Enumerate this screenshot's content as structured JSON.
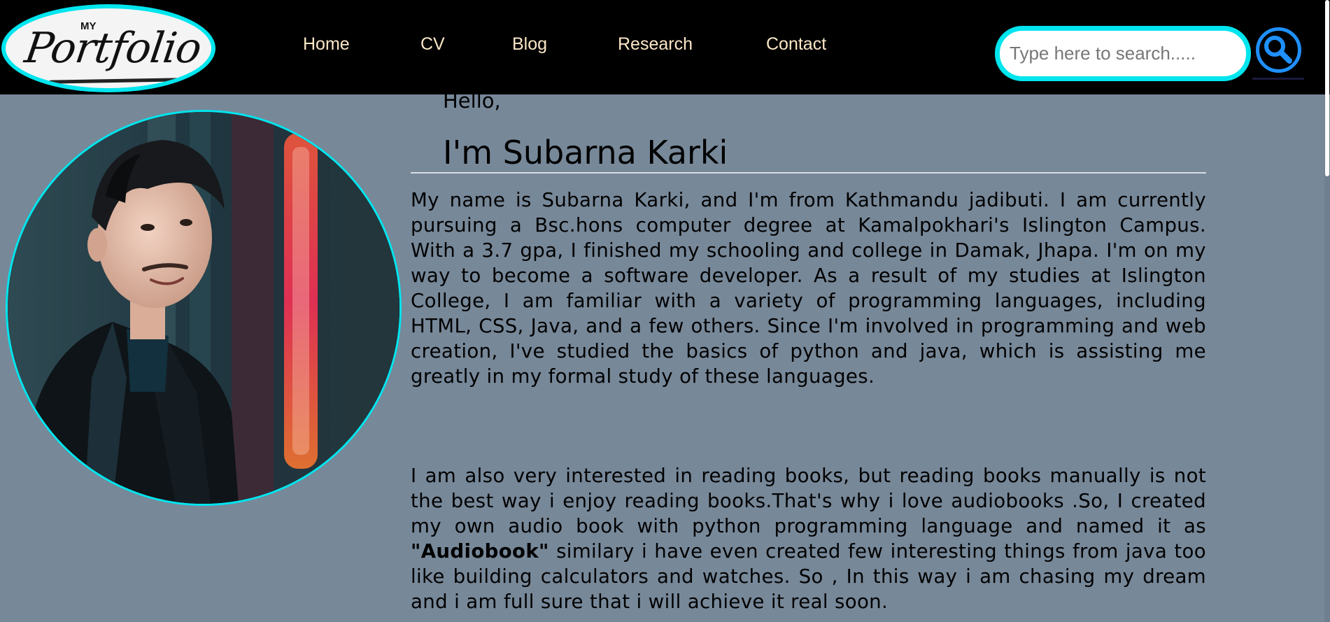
{
  "header": {
    "logo": {
      "small_text": "MY",
      "word": "Portfolio"
    },
    "nav": [
      {
        "label": "Home"
      },
      {
        "label": "CV"
      },
      {
        "label": "Blog"
      },
      {
        "label": "Research"
      },
      {
        "label": "Contact"
      }
    ],
    "search": {
      "placeholder": "Type here to search.....",
      "icon": "search-icon"
    }
  },
  "main": {
    "greeting": "Hello,",
    "name_heading": "I'm Subarna Karki",
    "paragraph1": "My name is Subarna Karki, and I'm from Kathmandu jadibuti. I am currently pursuing a Bsc.hons computer degree at Kamalpokhari's Islington Campus. With a 3.7 gpa, I finished my schooling and college in Damak, Jhapa. I'm on my way to become a software developer. As a result of my studies at Islington College, I am familiar with a variety of programming languages, including HTML, CSS, Java, and a few others. Since I'm involved in programming and web creation, I've studied the basics of python and java, which is assisting me greatly in my formal study of these languages.",
    "paragraph2": {
      "before": "I am also very interested in reading books, but reading books manually is not the best way i enjoy reading books.That's why i love audiobooks .So, I created my own audio book with python programming language and named it as ",
      "bold": "\"Audiobook\"",
      "after": " similary i have even created few interesting things from java too like building calculators and watches. So , In this way i am chasing my dream and i am full sure that i will achieve it real soon."
    }
  },
  "colors": {
    "nav_bg": "#000000",
    "page_bg": "#778899",
    "accent_cyan": "#00e5ee",
    "nav_text": "#fbe7c6",
    "search_blue": "#1e90ff"
  }
}
